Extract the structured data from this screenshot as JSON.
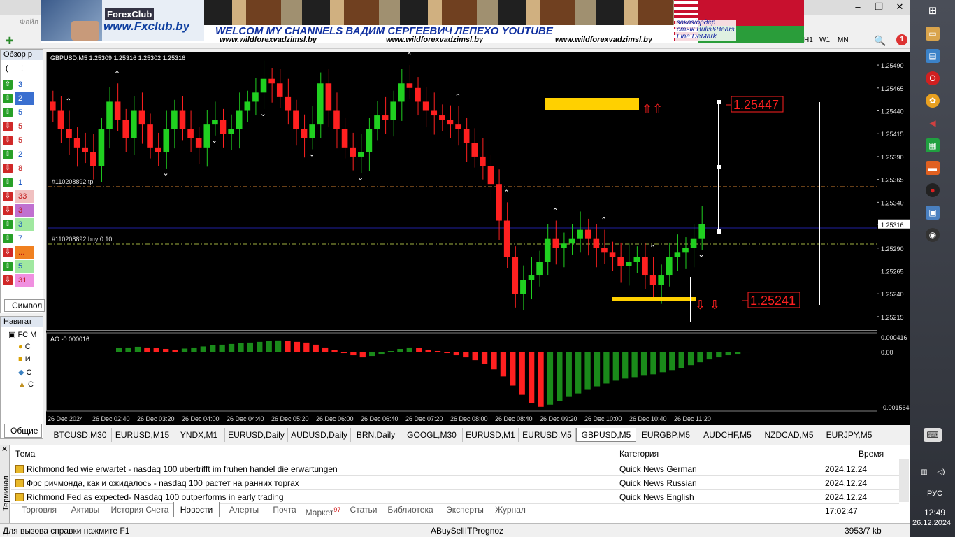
{
  "window": {
    "menu_file": "Файл",
    "controls": [
      "–",
      "❐",
      "✕"
    ]
  },
  "banner": {
    "logo": "ForexClub",
    "url": "www.Fxclub.by",
    "welcome": "WELCOM MY CHANNELS ВАДИМ СЕРГЕЕВИЧ ЛЕПЕХО YOUTUBE",
    "site": "www.wildforexvadzimsl.by",
    "order_lines": [
      "заказ/ордер",
      "стык Bulls&Bears",
      "Line DeMark"
    ]
  },
  "toolbar": {
    "timeframes": [
      "H1",
      "W1",
      "MN"
    ],
    "alerts_count": "1"
  },
  "market_watch": {
    "title": "Обзор р",
    "header": [
      "(",
      "!"
    ],
    "rows": [
      {
        "dir": "up",
        "val": "3",
        "bg": "#ffffff"
      },
      {
        "dir": "up",
        "val": "2",
        "bg": "#3a6fd0"
      },
      {
        "dir": "up",
        "val": "5",
        "bg": "#ffffff"
      },
      {
        "dir": "down",
        "val": "5",
        "bg": "#ffffff"
      },
      {
        "dir": "down",
        "val": "5",
        "bg": "#ffffff"
      },
      {
        "dir": "up",
        "val": "2",
        "bg": "#ffffff"
      },
      {
        "dir": "down",
        "val": "8",
        "bg": "#ffffff"
      },
      {
        "dir": "up",
        "val": "1",
        "bg": "#ffffff"
      },
      {
        "dir": "down",
        "val": "33",
        "bg": "#f0c0c0"
      },
      {
        "dir": "down",
        "val": "3",
        "bg": "#c070d0"
      },
      {
        "dir": "up",
        "val": "3",
        "bg": "#a0e8a0"
      },
      {
        "dir": "up",
        "val": "7",
        "bg": "#ffffff"
      },
      {
        "dir": "down",
        "val": "...",
        "bg": "#f08020"
      },
      {
        "dir": "up",
        "val": "5",
        "bg": "#a0e8a0"
      },
      {
        "dir": "down",
        "val": "31",
        "bg": "#f090e0"
      }
    ],
    "tab": "Символ"
  },
  "navigator": {
    "title": "Навигат",
    "items": [
      "FC M",
      "С",
      "И",
      "С",
      "С"
    ],
    "tab": "Общие"
  },
  "chart": {
    "symbol_header": "GBPUSD,M5  1.25309 1.25316 1.25302 1.25316",
    "tp_label": "#110208892 tp",
    "buy_label": "#110208892 buy 0.10",
    "level_high": "1.25447",
    "level_low": "1.25241",
    "current_price": "1.25316",
    "ao_label": "AO -0.000016",
    "ao_ticks": [
      "0.000416",
      "0.00",
      "-0.001564"
    ]
  },
  "chart_data": {
    "type": "candlestick",
    "y_ticks": [
      "1.25490",
      "1.25465",
      "1.25440",
      "1.25415",
      "1.25390",
      "1.25365",
      "1.25340",
      "1.25316",
      "1.25290",
      "1.25265",
      "1.25240",
      "1.25215"
    ],
    "x_ticks": [
      "26 Dec 2024",
      "26 Dec 02:40",
      "26 Dec 03:20",
      "26 Dec 04:00",
      "26 Dec 04:40",
      "26 Dec 05:20",
      "26 Dec 06:00",
      "26 Dec 06:40",
      "26 Dec 07:20",
      "26 Dec 08:00",
      "26 Dec 08:40",
      "26 Dec 09:20",
      "26 Dec 10:00",
      "26 Dec 10:40",
      "26 Dec 11:20"
    ],
    "ylim": [
      1.25205,
      1.255
    ],
    "close": [
      1.2544,
      1.2542,
      1.2541,
      1.254,
      1.25395,
      1.2538,
      1.2542,
      1.2545,
      1.2543,
      1.2541,
      1.2544,
      1.25425,
      1.254,
      1.25395,
      1.2542,
      1.2544,
      1.2542,
      1.2541,
      1.254,
      1.25425,
      1.2543,
      1.25415,
      1.2542,
      1.2544,
      1.2545,
      1.2546,
      1.25475,
      1.2547,
      1.25455,
      1.2544,
      1.2542,
      1.2541,
      1.25425,
      1.2547,
      1.2544,
      1.2542,
      1.254,
      1.2539,
      1.25395,
      1.2542,
      1.25435,
      1.2543,
      1.2545,
      1.2547,
      1.25465,
      1.2545,
      1.2544,
      1.25435,
      1.2543,
      1.25425,
      1.2542,
      1.25405,
      1.2539,
      1.2538,
      1.2536,
      1.2532,
      1.2528,
      1.2524,
      1.25255,
      1.2526,
      1.25275,
      1.253,
      1.2529,
      1.25295,
      1.253,
      1.2531,
      1.253,
      1.2529,
      1.25285,
      1.2528,
      1.2527,
      1.25275,
      1.2528,
      1.2526,
      1.2525,
      1.2526,
      1.2528,
      1.25285,
      1.2529,
      1.253,
      1.25316
    ],
    "ao": [
      0.0001,
      0.00012,
      0.00014,
      0.00012,
      0.0001,
      8e-05,
      6e-05,
      9e-05,
      0.00012,
      0.00015,
      0.00018,
      0.0002,
      0.00022,
      0.00024,
      0.00026,
      0.00028,
      0.0003,
      0.00032,
      0.0003,
      0.00028,
      0.00026,
      0.0002,
      0.00012,
      4e-05,
      -4e-05,
      -0.0001,
      -0.00016,
      -0.00012,
      -6e-05,
      2e-05,
      8e-05,
      0.00012,
      0.0001,
      6e-05,
      2e-05,
      -4e-05,
      -0.0001,
      -0.00016,
      -0.00024,
      -0.00034,
      -0.0005,
      -0.0007,
      -0.00096,
      -0.00122,
      -0.00146,
      -0.00156,
      -0.0015,
      -0.0014,
      -0.00128,
      -0.00118,
      -0.00108,
      -0.00098,
      -0.0009,
      -0.00082,
      -0.00076,
      -0.00072,
      -0.00068,
      -0.00064,
      -0.00058,
      -0.00052,
      -0.00046,
      -0.00038,
      -0.0003,
      -0.00022,
      -0.00016,
      -0.0001,
      -6e-05,
      -2e-05
    ]
  },
  "symbol_tabs": [
    "BTCUSD,M30",
    "EURUSD,M15",
    "YNDX,M1",
    "EURUSD,Daily",
    "AUDUSD,Daily",
    "BRN,Daily",
    "GOOGL,M30",
    "EURUSD,M1",
    "EURUSD,M5",
    "GBPUSD,M5",
    "EURGBP,M5",
    "AUDCHF,M5",
    "NZDCAD,M5",
    "EURJPY,M5"
  ],
  "terminal": {
    "side_label": "Терминал",
    "col_subject": "Тема",
    "col_category": "Категория",
    "col_time": "Время",
    "news": [
      {
        "title": "Richmond fed wie erwartet - nasdaq 100 ubertrifft im fruhen handel die erwartungen",
        "category": "Quick News German",
        "time": "2024.12.24 17:02:47"
      },
      {
        "title": "Фрс ричмонда, как и ожидалось - nasdaq 100 растет на ранних торгах",
        "category": "Quick News Russian",
        "time": "2024.12.24 17:02:47"
      },
      {
        "title": "Richmond Fed as expected- Nasdaq 100 outperforms in early trading",
        "category": "Quick News English",
        "time": "2024.12.24 17:02:47"
      }
    ],
    "tabs": [
      "Торговля",
      "Активы",
      "История Счета",
      "Новости",
      "Алерты",
      "Почта",
      "Маркет",
      "Статьи",
      "Библиотека",
      "Эксперты",
      "Журнал"
    ],
    "market_badge": "97",
    "active_tab": "Новости"
  },
  "status": {
    "help": "Для вызова справки нажмите F1",
    "profile": "ABuySellITPrognoz",
    "traffic": "3953/7 kb"
  },
  "taskbar": {
    "lang": "РУС",
    "time": "12:49",
    "date": "26.12.2024"
  }
}
